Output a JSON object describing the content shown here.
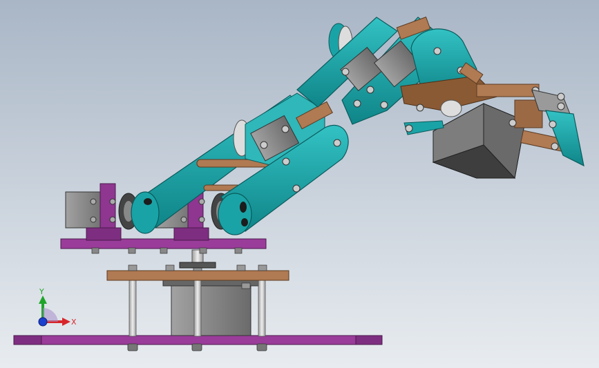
{
  "axes": {
    "y_label": "Y",
    "x_label": "X"
  },
  "colors": {
    "bg_top": "#a9b6c6",
    "bg_bottom": "#e6eaef",
    "teal": "#1aa3a6",
    "teal_dark": "#0d6f72",
    "teal_light": "#5fd0d2",
    "purple": "#9a3c9a",
    "purple_dark": "#5f1f62",
    "wood": "#b07a52",
    "wood_dark": "#6f4a2e",
    "servo": "#8e8e8e",
    "servo_dark": "#5a5a5a",
    "steel": "#c9c9c9"
  }
}
